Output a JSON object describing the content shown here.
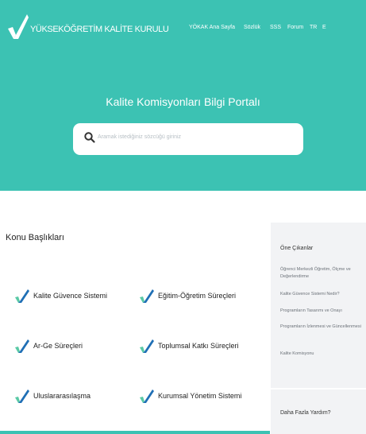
{
  "header": {
    "brand": "YÜKSEKÖĞRETİM KALİTE KURULU",
    "nav": [
      "YÖKAK Ana Sayfa",
      "Sözlük",
      "SSS",
      "Forum",
      "TR",
      "E"
    ]
  },
  "hero": {
    "title": "Kalite Komisyonları Bilgi Portalı",
    "search_placeholder": "Aramak istediğiniz sözcüğü giriniz"
  },
  "topics": {
    "title": "Konu Başlıkları",
    "items": [
      {
        "label": "Kalite Güvence Sistemi",
        "icon": "logo-check-icon"
      },
      {
        "label": "Eğitim-Öğretim Süreçleri",
        "icon": "logo-check-icon"
      },
      {
        "label": "Ar-Ge Süreçleri",
        "icon": "logo-check-icon"
      },
      {
        "label": "Toplumsal Katkı Süreçleri",
        "icon": "logo-check-icon"
      },
      {
        "label": "Uluslararasılaşma",
        "icon": "logo-check-icon"
      },
      {
        "label": "Kurumsal Yönetim Sistemi",
        "icon": "logo-check-icon"
      }
    ]
  },
  "sidebar": {
    "featured_title": "Öne Çıkanlar",
    "links": [
      "Öğrenci Merkezli Öğretim, Ölçme ve Değerlendirme",
      "Kalite Güvence Sistemi Nedir?",
      "Programların Tasarımı ve Onayı",
      "Programların İzlenmesi ve Güncellenmesi",
      "Kalite Komisyonu"
    ],
    "help_title": "Daha Fazla Yardım?"
  },
  "colors": {
    "accent": "#3cc2b3",
    "logo_dark": "#1f6fb5",
    "logo_light": "#59c9a5"
  }
}
